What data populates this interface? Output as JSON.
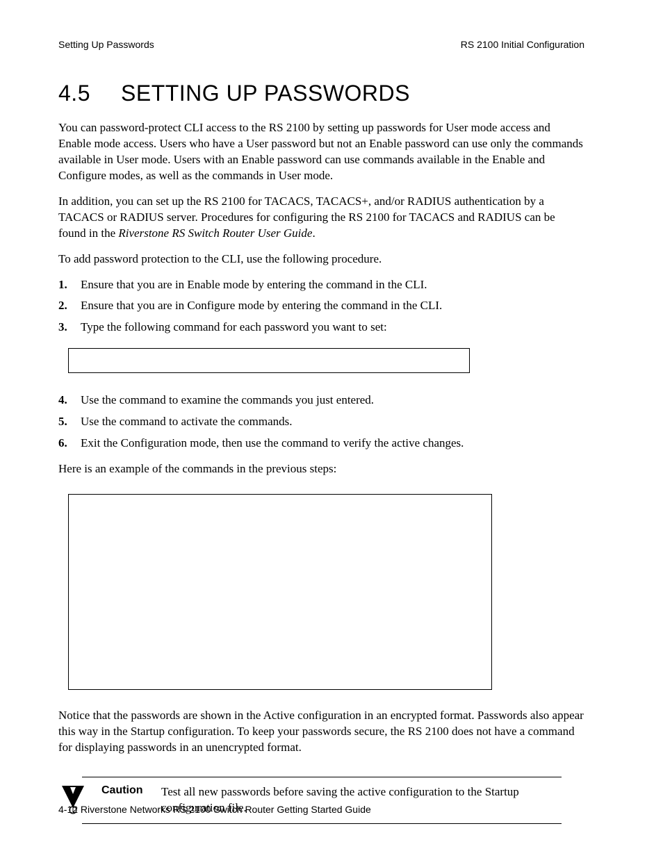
{
  "header": {
    "left": "Setting Up Passwords",
    "right": "RS 2100 Initial Configuration"
  },
  "section": {
    "number": "4.5",
    "title": "SETTING UP PASSWORDS"
  },
  "para1": "You can password-protect CLI access to the RS 2100 by setting up passwords for User mode access and Enable mode access. Users who have a User password but not an Enable password can use only the commands available in User mode. Users with an Enable password can use commands available in the Enable and Configure modes, as well as the commands in User mode.",
  "para2a": "In addition, you can set up the RS 2100 for TACACS, TACACS+, and/or RADIUS authentication by a TACACS or RADIUS server. Procedures for configuring the RS 2100 for TACACS and RADIUS can be found in the ",
  "para2b_italic": "Riverstone RS Switch Router User Guide",
  "para2c": ".",
  "para3": "To add password protection to the CLI, use the following procedure.",
  "steps_a": [
    "Ensure that you are in Enable mode by entering the               command in the CLI.",
    "Ensure that you are in Configure mode by entering the                     command in the CLI.",
    "Type the following command for each password you want to set:"
  ],
  "steps_b": [
    "Use the            command to examine the commands you just entered.",
    "Use the                       command to activate the commands.",
    "Exit the Configuration mode, then use the                                                           command to verify the active changes."
  ],
  "para4": "Here is an example of the commands in the previous steps:",
  "para5": "Notice that the passwords are shown in the Active configuration in an encrypted format. Passwords also appear this way in the Startup configuration. To keep your passwords secure, the RS 2100 does not have a command for displaying passwords in an unencrypted format.",
  "caution": {
    "label": "Caution",
    "text": "Test all new passwords before saving the active configuration to the Startup configuration file."
  },
  "footer": "4-12   Riverstone Networks RS 2100 Switch Router Getting Started Guide"
}
